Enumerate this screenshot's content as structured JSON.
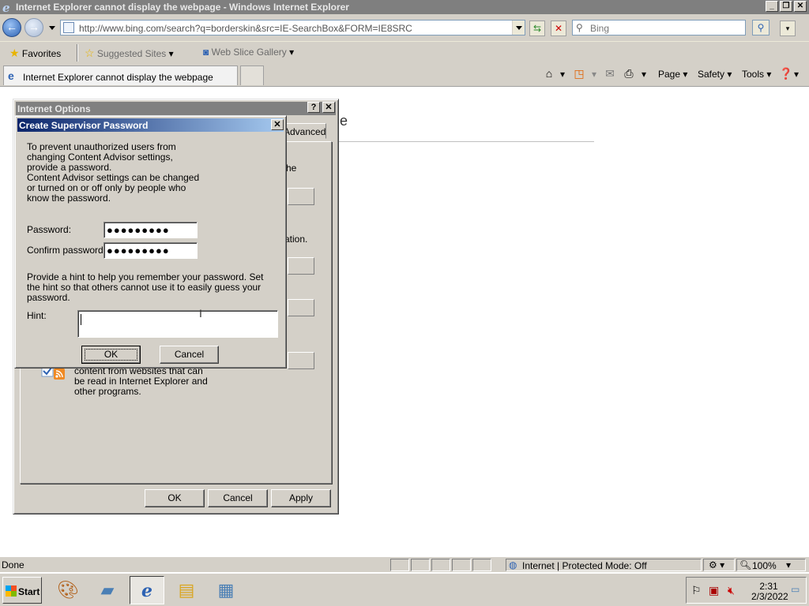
{
  "window": {
    "title": "Internet Explorer cannot display the webpage - Windows Internet Explorer",
    "controls": [
      "_",
      "❐",
      "✕"
    ]
  },
  "address_bar": {
    "url": "http://www.bing.com/search?q=borderskin&src=IE-SearchBox&FORM=IE8SRC",
    "search_placeholder": "Bing"
  },
  "favorites_bar": {
    "favorites_label": "Favorites",
    "suggested_sites_label": "Suggested Sites",
    "web_slice_label": "Web Slice Gallery"
  },
  "tabs": {
    "active_tab_label": "Internet Explorer cannot display the webpage"
  },
  "command_bar": {
    "page_label": "Page",
    "safety_label": "Safety",
    "tools_label": "Tools"
  },
  "content": {
    "heading_fragment": "e"
  },
  "internet_options": {
    "title": "Internet Options",
    "help_label": "?",
    "tab_advanced": "Advanced",
    "fragment_he": "he",
    "fragment_ation": "ation.",
    "fragment_feeds": "content from websites that can be read in Internet Explorer and other programs.",
    "ok_label": "OK",
    "cancel_label": "Cancel",
    "apply_label": "Apply"
  },
  "supervisor_dialog": {
    "title": "Create Supervisor Password",
    "intro_1": "To prevent unauthorized users from changing Content Advisor settings, provide a password.",
    "intro_2": "Content Advisor settings can be changed or turned on or off only by people who know the password.",
    "password_label": "Password:",
    "password_value": "●●●●●●●●●",
    "confirm_label": "Confirm password:",
    "confirm_value": "●●●●●●●●●",
    "hint_instructions": "Provide a hint to help you remember your password. Set the hint so that others cannot use it to easily guess your password.",
    "hint_label": "Hint:",
    "hint_value": "",
    "ok_label": "OK",
    "cancel_label": "Cancel"
  },
  "status_bar": {
    "status_text": "Done",
    "zone_text": "Internet | Protected Mode: Off",
    "zoom_text": "100%"
  },
  "taskbar": {
    "start_label": "Start",
    "time": "2:31",
    "date": "2/3/2022"
  }
}
